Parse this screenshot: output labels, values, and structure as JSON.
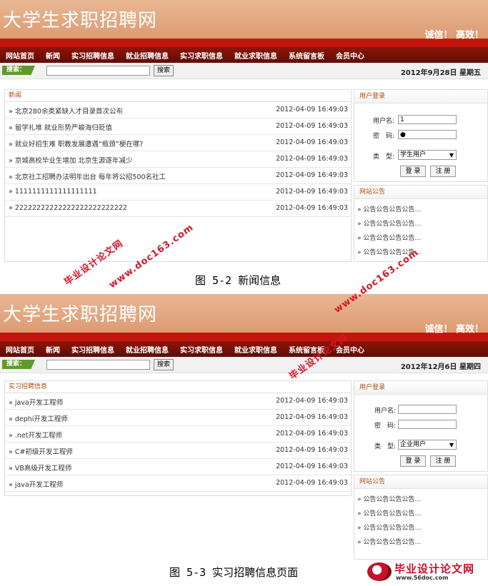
{
  "screen1": {
    "title": "大学生求职招聘网",
    "slogan": "诚信！ 高效！",
    "nav": [
      "网站首页",
      "新闻",
      "实习招聘信息",
      "就业招聘信息",
      "实习求职信息",
      "就业求职信息",
      "系统留言板",
      "会员中心"
    ],
    "search_label": "搜索：",
    "search_button": "搜索",
    "date": "2012年9月28日 星期五",
    "panel_title": "新闻",
    "rows": [
      {
        "title": "» 北京280余类紧缺人才目录首次公布",
        "date": "2012-04-09 16:49:03"
      },
      {
        "title": "» 留学扎堆 就业形势严峻海归贬值",
        "date": "2012-04-09 16:49:03"
      },
      {
        "title": "» 就业好招生难 职教发展遭遇“瓶颈”梗在哪?",
        "date": "2012-04-09 16:49:03"
      },
      {
        "title": "» 京城高校毕业生增加 北京生源逐年减少",
        "date": "2012-04-09 16:49:03"
      },
      {
        "title": "» 北京社工招聘办法明年出台 每年将公招500名社工",
        "date": "2012-04-09 16:49:03"
      },
      {
        "title": "» 1111111111111111111",
        "date": "2012-04-09 16:49:03"
      },
      {
        "title": "» 22222222222222222222222222",
        "date": "2012-04-09 16:49:03"
      }
    ],
    "login": {
      "title": "用户登录",
      "username_label": "用户名:",
      "username_value": "1",
      "password_label": "密　码:",
      "password_value": "●",
      "type_label": "类　型:",
      "type_value": "学生用户",
      "login_button": "登 录",
      "register_button": "注 册"
    },
    "notice": {
      "title": "网站公告",
      "items": [
        "» 公告公告公告公告…",
        "» 公告公告公告公告…",
        "» 公告公告公告公告…",
        "» 公告公告公告公告…"
      ]
    }
  },
  "caption1": "图 5-2 新闻信息",
  "screen2": {
    "title": "大学生求职招聘网",
    "slogan": "诚信！ 高效！",
    "nav": [
      "网站首页",
      "新闻",
      "实习招聘信息",
      "就业招聘信息",
      "实习求职信息",
      "就业求职信息",
      "系统留言板",
      "会员中心"
    ],
    "search_label": "搜索：",
    "search_button": "搜索",
    "date": "2012年12月6日 星期四",
    "panel_title": "实习招聘信息",
    "rows": [
      {
        "title": "» java开发工程师",
        "date": "2012-04-09 16:49:03"
      },
      {
        "title": "» dephi开发工程师",
        "date": "2012-04-09 16:49:03"
      },
      {
        "title": "» .net开发工程师",
        "date": "2012-04-09 16:49:03"
      },
      {
        "title": "» C#初级开发工程师",
        "date": "2012-04-09 16:49:03"
      },
      {
        "title": "» VB高级开发工程师",
        "date": "2012-04-09 16:49:03"
      },
      {
        "title": "» java开发工程师",
        "date": "2012-04-09 16:49:03"
      }
    ],
    "login": {
      "title": "用户登录",
      "username_label": "用户名:",
      "username_value": "",
      "password_label": "密　码:",
      "password_value": "",
      "type_label": "类　型:",
      "type_value": "企业用户",
      "login_button": "登 录",
      "register_button": "注 册"
    },
    "notice": {
      "title": "网站公告",
      "items": [
        "» 公告公告公告公告…",
        "» 公告公告公告公告…",
        "» 公告公告公告公告…",
        "» 公告公告公告公告…"
      ]
    }
  },
  "caption2": "图 5-3 实习招聘信息页面",
  "watermarks": [
    "毕业设计论文网",
    "www.doc163.com"
  ],
  "logo": {
    "name": "毕业设计论文网",
    "url": "www.56doc.com"
  },
  "colors": {
    "header": "#dc9b72",
    "red_bar": "#c4150c",
    "nav": "#7a1206",
    "accent": "#b24a10",
    "watermark": "#d8152a"
  }
}
